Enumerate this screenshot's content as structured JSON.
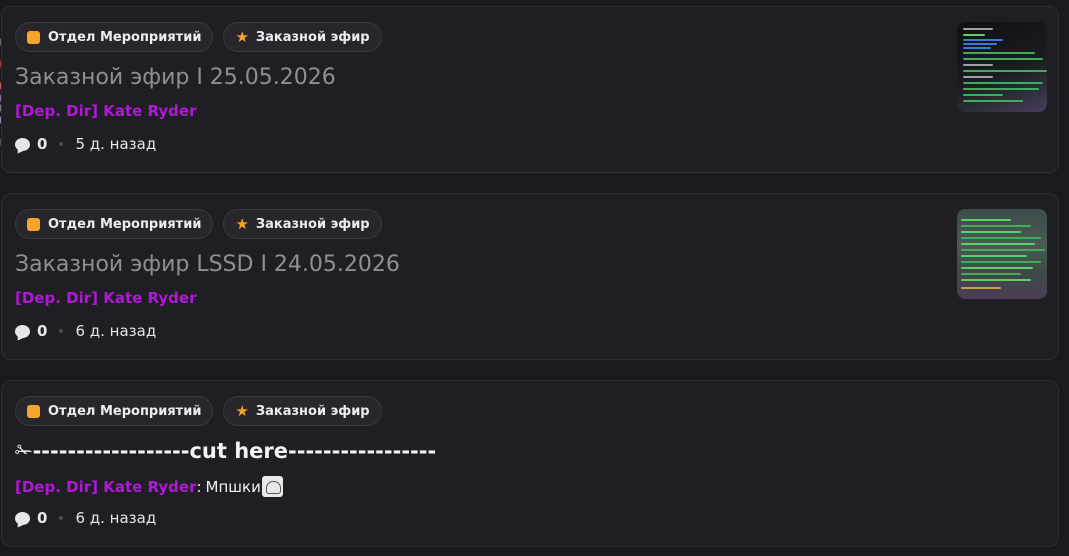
{
  "posts": [
    {
      "tags": [
        {
          "label": "Отдел Мероприятий",
          "icon": "orange-square-icon"
        },
        {
          "label": "Заказной эфир",
          "icon": "star-icon"
        }
      ],
      "title": "Заказной эфир I 25.05.2026",
      "author": "[Dep. Dir] Kate Ryder",
      "comments": "0",
      "time": "5 д. назад",
      "has_thumbnail": true
    },
    {
      "tags": [
        {
          "label": "Отдел Мероприятий",
          "icon": "orange-square-icon"
        },
        {
          "label": "Заказной эфир",
          "icon": "star-icon"
        }
      ],
      "title": "Заказной эфир LSSD I 24.05.2026",
      "author": "[Dep. Dir] Kate Ryder",
      "comments": "0",
      "time": "6 д. назад",
      "has_thumbnail": true
    },
    {
      "tags": [
        {
          "label": "Отдел Мероприятий",
          "icon": "orange-square-icon"
        },
        {
          "label": "Заказной эфир",
          "icon": "star-icon"
        }
      ],
      "title": "✁------------------cut here-----------------",
      "author": "[Dep. Dir] Kate Ryder",
      "author_suffix": ":",
      "message": "Мпшки",
      "comments": "0",
      "time": "6 д. назад",
      "has_thumbnail": false
    }
  ],
  "colors": {
    "background": "#1a1a1e",
    "card": "#1f1f23",
    "author": "#b018d8",
    "tag_square": "#f6a42c",
    "star": "#f5a623"
  }
}
